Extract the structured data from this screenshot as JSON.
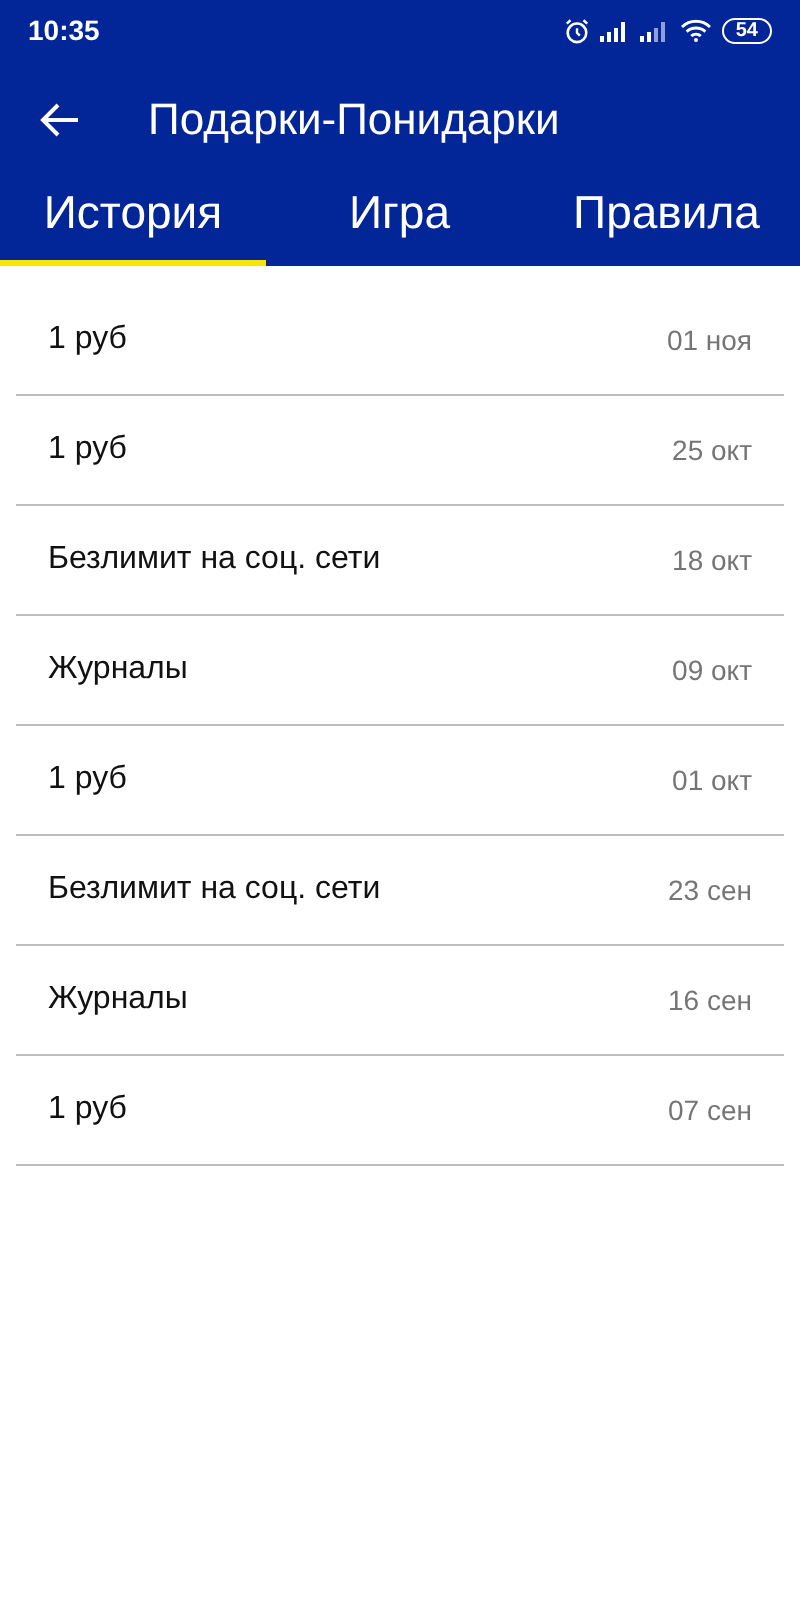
{
  "status_bar": {
    "time": "10:35",
    "battery": "54"
  },
  "app_bar": {
    "title": "Подарки-Понидарки"
  },
  "tabs": [
    {
      "label": "История",
      "selected": true
    },
    {
      "label": "Игра",
      "selected": false
    },
    {
      "label": "Правила",
      "selected": false
    }
  ],
  "history": [
    {
      "prize": "1 руб",
      "date": "01 ноя"
    },
    {
      "prize": "1 руб",
      "date": "25 окт"
    },
    {
      "prize": "Безлимит на соц. сети",
      "date": "18 окт"
    },
    {
      "prize": "Журналы",
      "date": "09 окт"
    },
    {
      "prize": "1 руб",
      "date": "01 окт"
    },
    {
      "prize": "Безлимит на соц. сети",
      "date": "23 сен"
    },
    {
      "prize": "Журналы",
      "date": "16 сен"
    },
    {
      "prize": "1 руб",
      "date": "07 сен"
    }
  ]
}
